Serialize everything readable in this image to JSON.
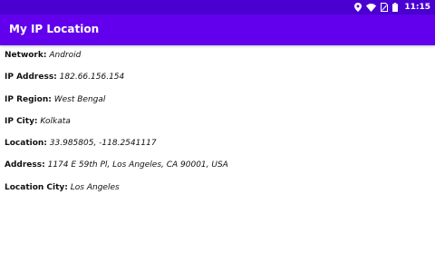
{
  "status_bar": {
    "time": "11:15",
    "icons": [
      "location-icon",
      "wifi-icon",
      "sim-icon",
      "battery-icon"
    ],
    "color": "#4a00d1"
  },
  "app_bar": {
    "title": "My IP Location",
    "color": "#6200ee"
  },
  "info": [
    {
      "label": "Network:",
      "value": "Android"
    },
    {
      "label": "IP Address:",
      "value": "182.66.156.154"
    },
    {
      "label": "IP Region:",
      "value": "West Bengal"
    },
    {
      "label": "IP City:",
      "value": "Kolkata"
    },
    {
      "label": "Location:",
      "value": "33.985805, -118.2541117"
    },
    {
      "label": "Address:",
      "value": "1174 E 59th Pl, Los Angeles, CA 90001, USA"
    },
    {
      "label": "Location City:",
      "value": "Los Angeles"
    }
  ]
}
